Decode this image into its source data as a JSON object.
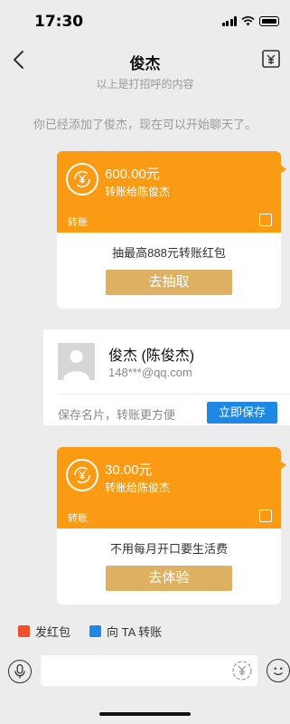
{
  "status_bar": {
    "time": "17:30"
  },
  "header": {
    "title": "俊杰",
    "subtitle": "以上是打招呼的内容"
  },
  "system_notice": "你已经添加了俊杰，现在可以开始聊天了。",
  "transfers": [
    {
      "amount": "600.00元",
      "description": "转账给陈俊杰",
      "label": "转账",
      "promo_text": "抽最高888元转账红包",
      "button_label": "去抽取"
    },
    {
      "amount": "30.00元",
      "description": "转账给陈俊杰",
      "label": "转账",
      "promo_text": "不用每月开口要生活费",
      "button_label": "去体验"
    }
  ],
  "contact_card": {
    "name": "俊杰 (陈俊杰)",
    "email": "148***@qq.com",
    "hint": "保存名片，转账更方便",
    "save_button": "立即保存"
  },
  "quick_actions": [
    {
      "label": "发红包",
      "icon": "red-envelope-icon",
      "color": "#f0502c"
    },
    {
      "label": "向 TA 转账",
      "icon": "transfer-icon",
      "color": "#1e88e5"
    }
  ],
  "input_bar": {
    "placeholder": ""
  },
  "colors": {
    "transfer_orange": "#fb9a13",
    "promo_gold": "#deb162",
    "save_blue": "#1e88e5"
  }
}
